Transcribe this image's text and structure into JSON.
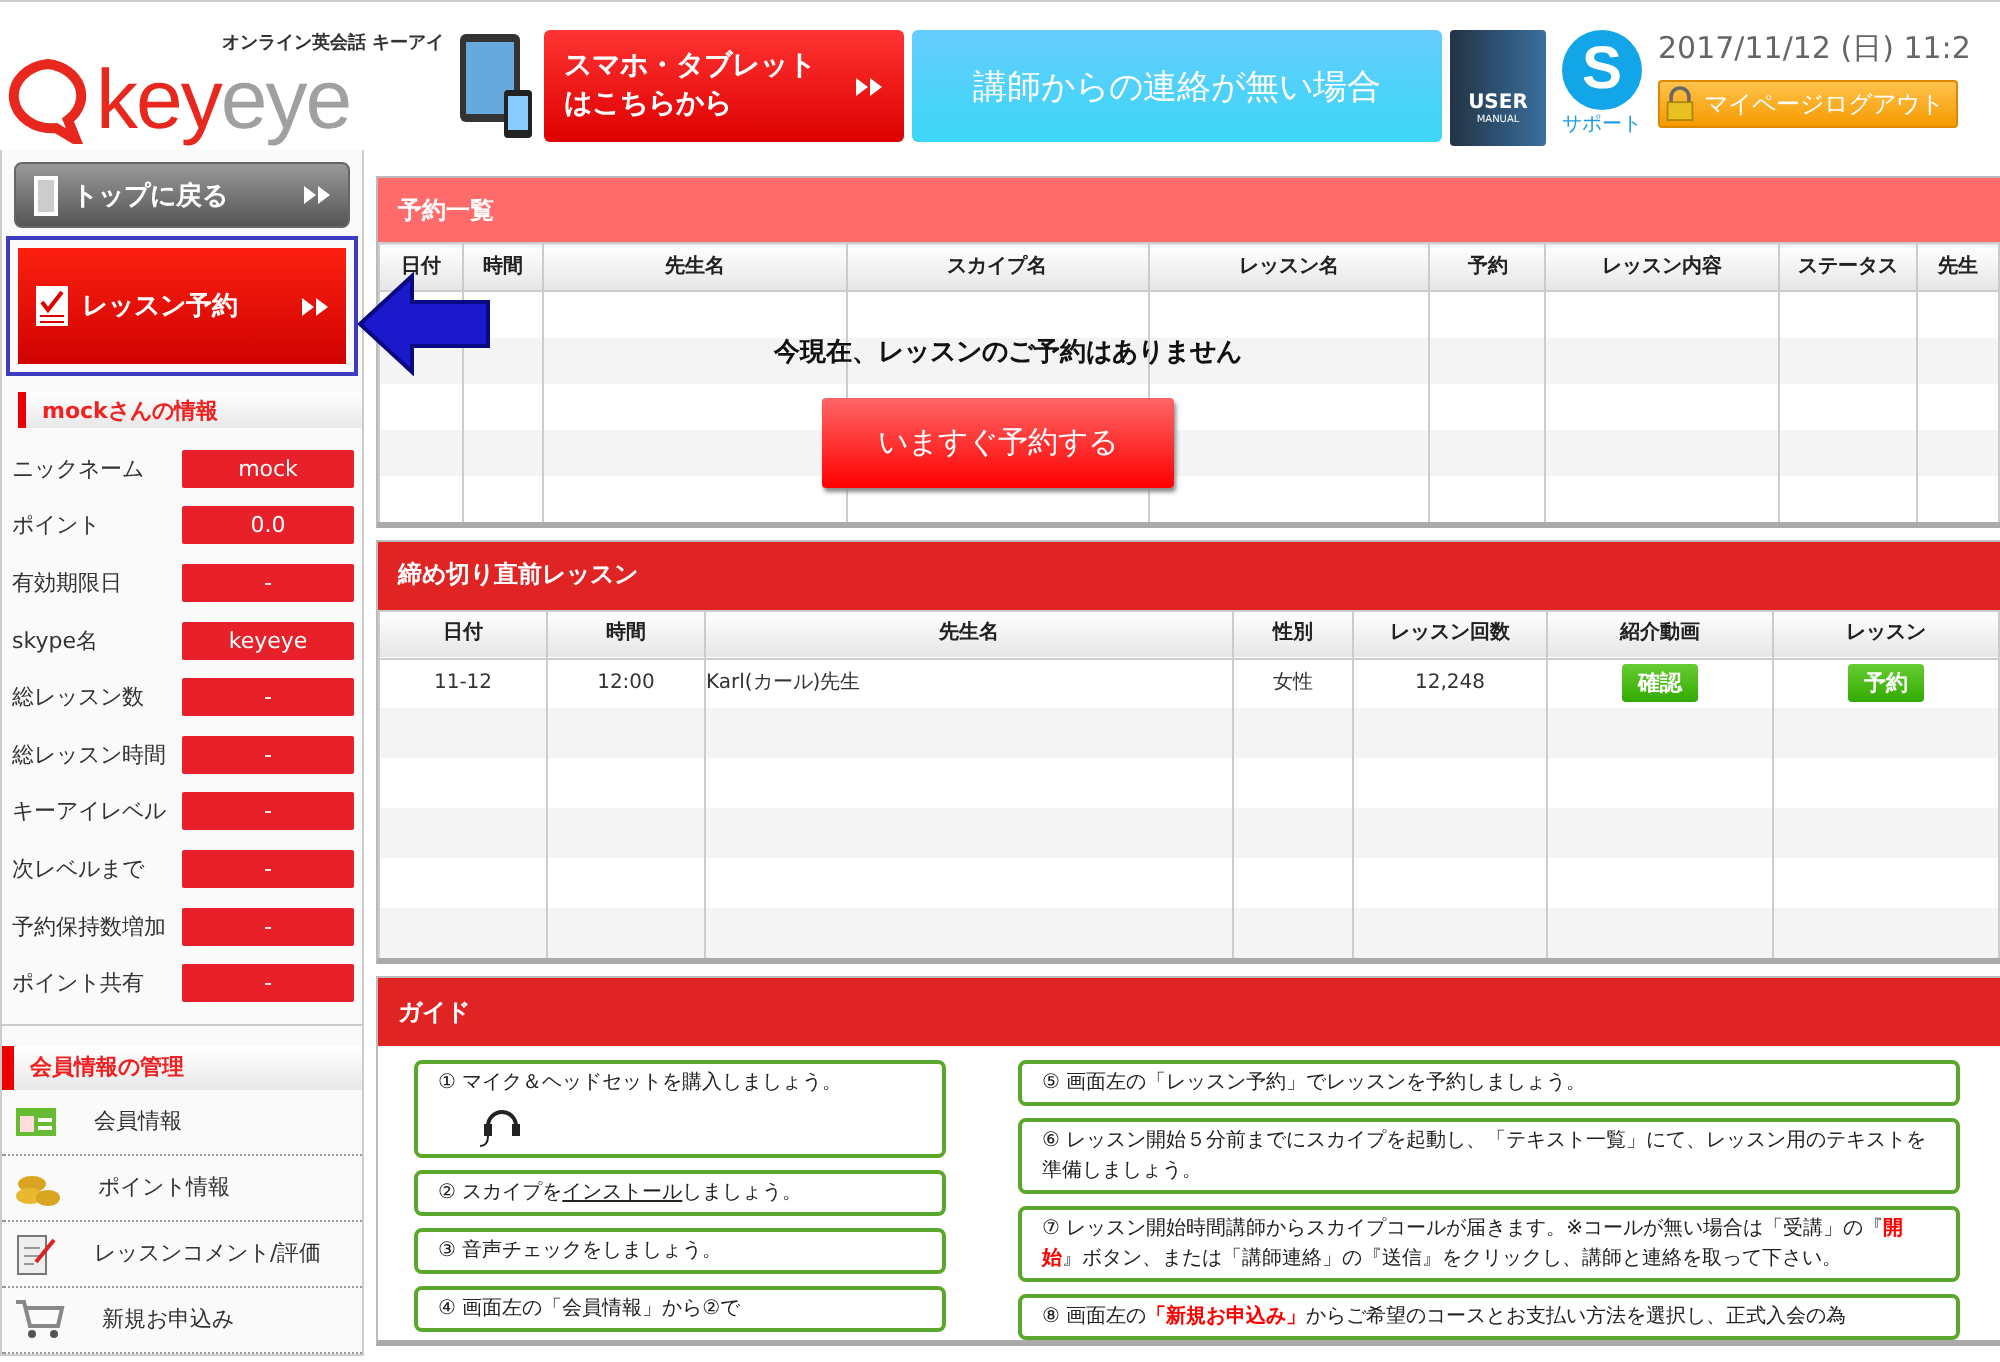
{
  "header": {
    "logo_tagline": "オンライン英会話 キーアイ",
    "logo_parts": [
      {
        "text": "key",
        "color": "#e8281e"
      },
      {
        "text": "eye",
        "color": "#a0a0a0"
      }
    ],
    "banners": [
      {
        "kind": "tablet",
        "lines": [
          "スマホ・タブレット",
          "はこちらから"
        ]
      },
      {
        "kind": "contact",
        "lines": [
          "講師からの連絡が無い場合"
        ]
      }
    ],
    "manual": {
      "line1": "USER",
      "line2": "MANUAL"
    },
    "support": {
      "mark": "S",
      "label": "サポート"
    },
    "datetime": "2017/11/12 (日) 11:2",
    "logout": "マイページログアウト"
  },
  "sidebar": {
    "buttons": [
      {
        "label": "トップに戻る",
        "kind": "gray",
        "selected": false
      },
      {
        "label": "レッスン予約",
        "kind": "red",
        "selected": true
      }
    ],
    "info_title": "mockさんの情報",
    "info": [
      {
        "label": "ニックネーム",
        "value": "mock"
      },
      {
        "label": "ポイント",
        "value": "0.0"
      },
      {
        "label": "有効期限日",
        "value": "-"
      },
      {
        "label": "skype名",
        "value": "keyeye"
      },
      {
        "label": "総レッスン数",
        "value": "-"
      },
      {
        "label": "総レッスン時間",
        "value": "-"
      },
      {
        "label": "キーアイレベル",
        "value": "-"
      },
      {
        "label": "次レベルまで",
        "value": "-"
      },
      {
        "label": "予約保持数増加",
        "value": "-"
      },
      {
        "label": "ポイント共有",
        "value": "-"
      }
    ],
    "manage_title": "会員情報の管理",
    "manage": [
      {
        "label": "会員情報",
        "kind": "card"
      },
      {
        "label": "ポイント情報",
        "kind": "coins"
      },
      {
        "label": "レッスンコメント/評価",
        "kind": "clipboard"
      },
      {
        "label": "新規お申込み",
        "kind": "cart"
      }
    ]
  },
  "reservations": {
    "title": "予約一覧",
    "columns": [
      "日付",
      "時間",
      "先生名",
      "スカイプ名",
      "レッスン名",
      "予約",
      "レッスン内容",
      "ステータス",
      "先生"
    ],
    "empty_message": "今現在、レッスンのご予約はありません",
    "book_button": "いますぐ予約する"
  },
  "deadline": {
    "title": "締め切り直前レッスン",
    "columns": [
      "日付",
      "時間",
      "先生名",
      "性別",
      "レッスン回数",
      "紹介動画",
      "レッスン"
    ],
    "rows": [
      {
        "date": "11-12",
        "time": "12:00",
        "teacher": "Karl(カール)先生",
        "gender": "女性",
        "count": "12,248",
        "video_button": "確認",
        "lesson_button": "予約"
      }
    ]
  },
  "guide": {
    "title": "ガイド",
    "left": [
      {
        "kind": "headset",
        "text": "① マイク＆ヘッドセットを購入しましょう。"
      },
      {
        "kind": "link",
        "before": "② スカイプを",
        "link": "インストール",
        "after": "しましょう。"
      },
      {
        "kind": "text",
        "text": "③ 音声チェックをしましょう。"
      },
      {
        "kind": "text",
        "text": "④ 画面左の「会員情報」から②で"
      }
    ],
    "right": [
      {
        "kind": "text",
        "text": "⑤ 画面左の「レッスン予約」でレッスンを予約しましょう。"
      },
      {
        "kind": "text",
        "text": "⑥ レッスン開始５分前までにスカイプを起動し、「テキスト一覧」にて、レッスン用のテキストを準備しましょう。"
      },
      {
        "kind": "text",
        "text": "⑦ レッスン開始時間講師からスカイプコールが届きます。※コールが無い場合は「受講」の『**開始**』ボタン、または「講師連絡」の『送信』をクリックし、講師と連絡を取って下さい。"
      },
      {
        "kind": "text",
        "text": "⑧ 画面左の**「新規お申込み」**からご希望のコースとお支払い方法を選択し、正式入会の為"
      }
    ]
  }
}
